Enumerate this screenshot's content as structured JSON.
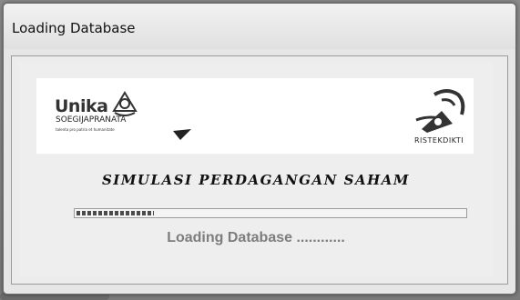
{
  "window": {
    "title": "Loading Database"
  },
  "logos": {
    "left": {
      "name": "Unika",
      "subtitle": "SOEGIJAPRANATA",
      "tagline": "talenta pro patria et humanitate"
    },
    "right": {
      "name": "RISTEKDIKTI"
    }
  },
  "main": {
    "app_title": "SIMULASI PERDAGANGAN SAHAM",
    "status": "Loading Database ............"
  },
  "progress": {
    "fraction": 0.2
  },
  "colors": {
    "window_bg": "#e6e6e6",
    "progress_fill": "#4a4a4a",
    "status_text": "#7d7d7d"
  },
  "icons": {
    "unika_emblem": "unika-emblem-icon",
    "ristek_emblem": "ristekdikti-emblem-icon"
  }
}
